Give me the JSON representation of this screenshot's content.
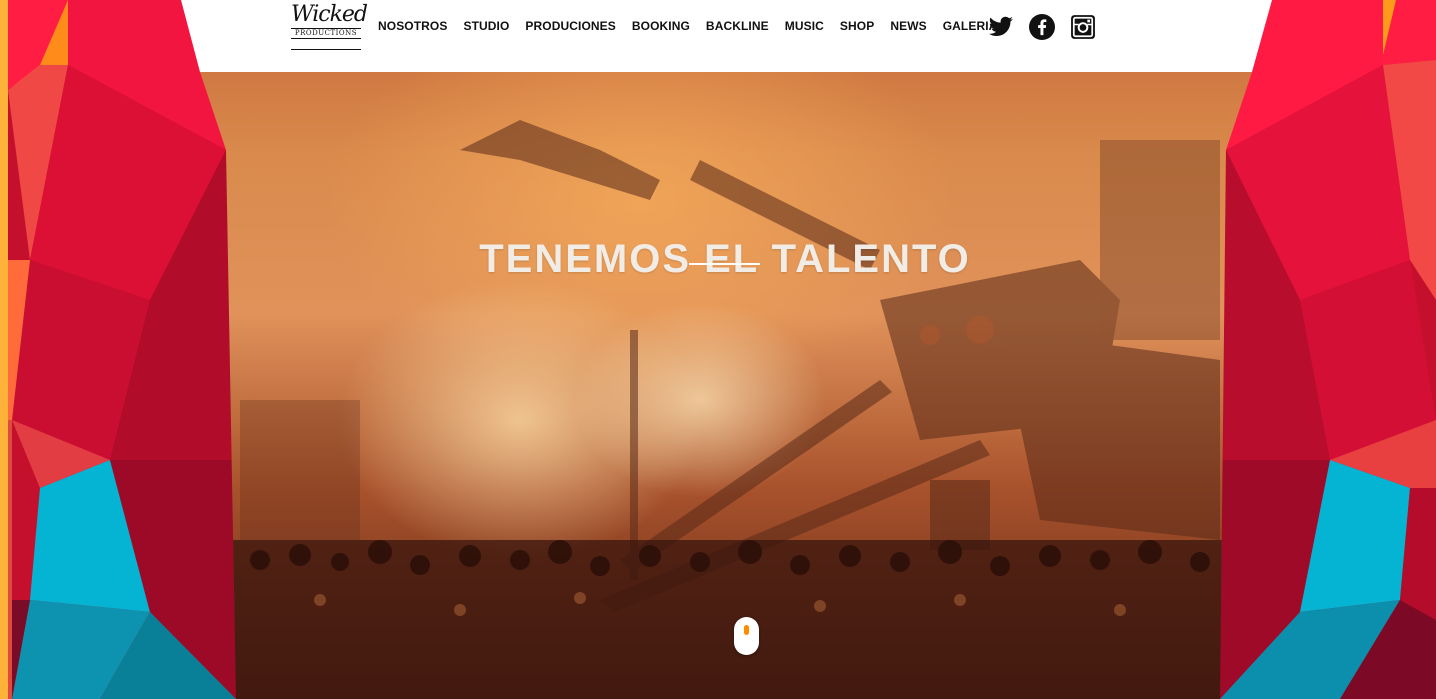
{
  "brand": {
    "logo_script": "Wicked",
    "logo_sub": "PRODUCTIONS"
  },
  "nav": {
    "items": [
      {
        "label": "NOSOTROS",
        "id": "nosotros"
      },
      {
        "label": "STUDIO",
        "id": "studio"
      },
      {
        "label": "PRODUCIONES",
        "id": "produciones"
      },
      {
        "label": "BOOKING",
        "id": "booking"
      },
      {
        "label": "BACKLINE",
        "id": "backline"
      },
      {
        "label": "MUSIC",
        "id": "music"
      },
      {
        "label": "SHOP",
        "id": "shop"
      },
      {
        "label": "NEWS",
        "id": "news"
      },
      {
        "label": "GALERIA",
        "id": "galeria"
      }
    ]
  },
  "social": [
    {
      "name": "twitter-icon"
    },
    {
      "name": "facebook-icon"
    },
    {
      "name": "instagram-icon"
    }
  ],
  "hero": {
    "title": "TENEMOS EL TALENTO"
  },
  "colors": {
    "accent_red": "#e8143c",
    "accent_cyan": "#00b4d2",
    "accent_orange": "#ff8a00",
    "header_bg": "#ffffff",
    "nav_text": "#111111",
    "hero_text": "#f2ece6"
  }
}
